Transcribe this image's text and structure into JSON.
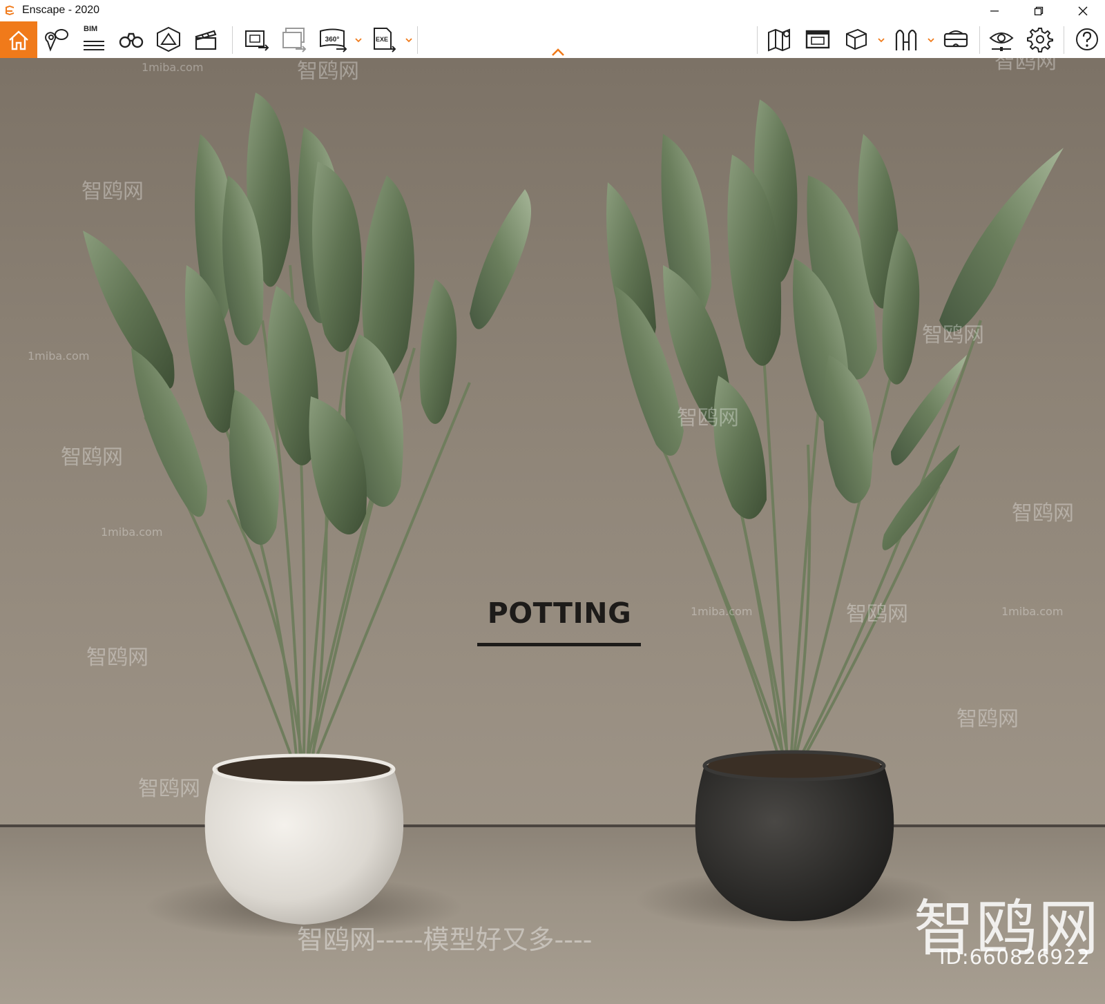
{
  "window": {
    "title": "Enscape - 2020",
    "controls": [
      "minimize",
      "restore",
      "close"
    ]
  },
  "toolbar": {
    "accent_color": "#f07a1a",
    "left_buttons": [
      "home-icon",
      "views-icon",
      "bim-icon",
      "binoculars-icon",
      "mountain-icon",
      "video-clapper-icon",
      "screenshot-export-icon",
      "batch-render-icon",
      "panorama-360-icon",
      "exe-export-icon"
    ],
    "bim_label": "BIM",
    "panorama_label": "360°",
    "exe_label": "EXE",
    "right_buttons": [
      "map-icon",
      "screenshot-icon",
      "cube-icon",
      "asset-library-icon",
      "vr-headset-icon",
      "visual-settings-icon",
      "settings-gear-icon",
      "help-icon"
    ]
  },
  "viewport": {
    "center_label": "POTTING",
    "watermarks": {
      "brand": "智鸥网",
      "site": "1miba.com",
      "slogan": "智鸥网-----模型好又多----",
      "big": "智鸥网",
      "id": "ID:660826922",
      "dashes": "-----"
    }
  }
}
